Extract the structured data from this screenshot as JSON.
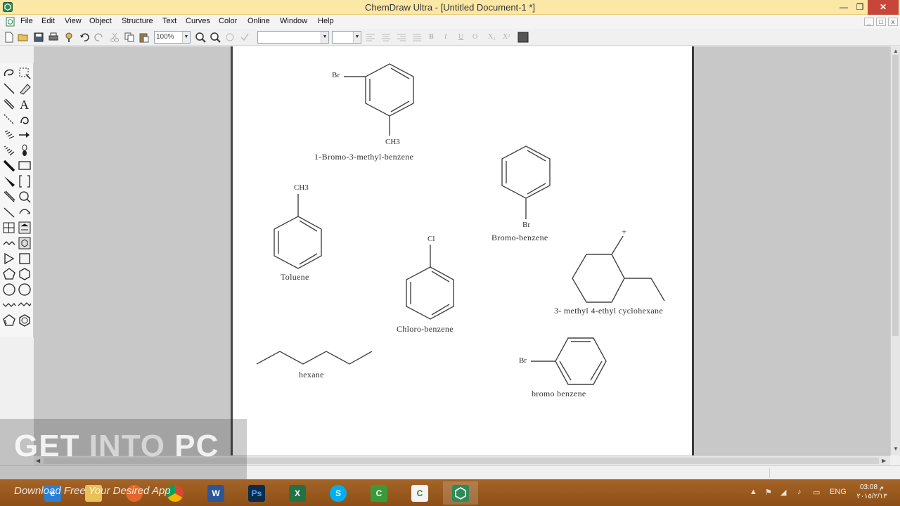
{
  "window": {
    "title": "ChemDraw Ultra - [Untitled Document-1 *]",
    "min": "—",
    "max": "❐",
    "close": "✕"
  },
  "menu": [
    "File",
    "Edit",
    "View",
    "Object",
    "Structure",
    "Text",
    "Curves",
    "Color",
    "Online",
    "Window",
    "Help"
  ],
  "toolbar": {
    "zoom": "100%",
    "font": "",
    "size": ""
  },
  "canvas": {
    "molecules": [
      {
        "name": "1-Bromo-3-methyl-benzene",
        "atoms": [
          "Br",
          "CH3"
        ]
      },
      {
        "name": "Bromo-benzene",
        "atoms": [
          "Br"
        ]
      },
      {
        "name": "Toluene",
        "atoms": [
          "CH3"
        ]
      },
      {
        "name": "Chloro-benzene",
        "atoms": [
          "Cl"
        ]
      },
      {
        "name": "3- methyl 4-ethyl cyclohexane",
        "atoms": []
      },
      {
        "name": "hexane",
        "atoms": []
      },
      {
        "name": "bromo benzene",
        "atoms": [
          "Br"
        ]
      }
    ]
  },
  "watermark": {
    "title_a": "GET ",
    "title_b": "INTO",
    "title_c": " PC",
    "subtitle": "Download Free Your Desired App"
  },
  "taskbar": {
    "apps": [
      {
        "name": "ie",
        "label": "e"
      },
      {
        "name": "explorer",
        "label": ""
      },
      {
        "name": "firefox",
        "label": ""
      },
      {
        "name": "chrome",
        "label": ""
      },
      {
        "name": "word",
        "label": "W"
      },
      {
        "name": "photoshop",
        "label": "Ps"
      },
      {
        "name": "excel",
        "label": "X"
      },
      {
        "name": "skype",
        "label": "S"
      },
      {
        "name": "camtasia",
        "label": "C"
      },
      {
        "name": "camtasia-recorder",
        "label": "C"
      },
      {
        "name": "chemdraw",
        "label": ""
      }
    ],
    "lang": "ENG",
    "time": "03:08 م",
    "date": "٢٠١٥/٢/١٣"
  },
  "colors": {
    "titlebar": "#fbe7a6",
    "taskbar": "#9a5a20",
    "workspace": "#c8c8c8"
  }
}
